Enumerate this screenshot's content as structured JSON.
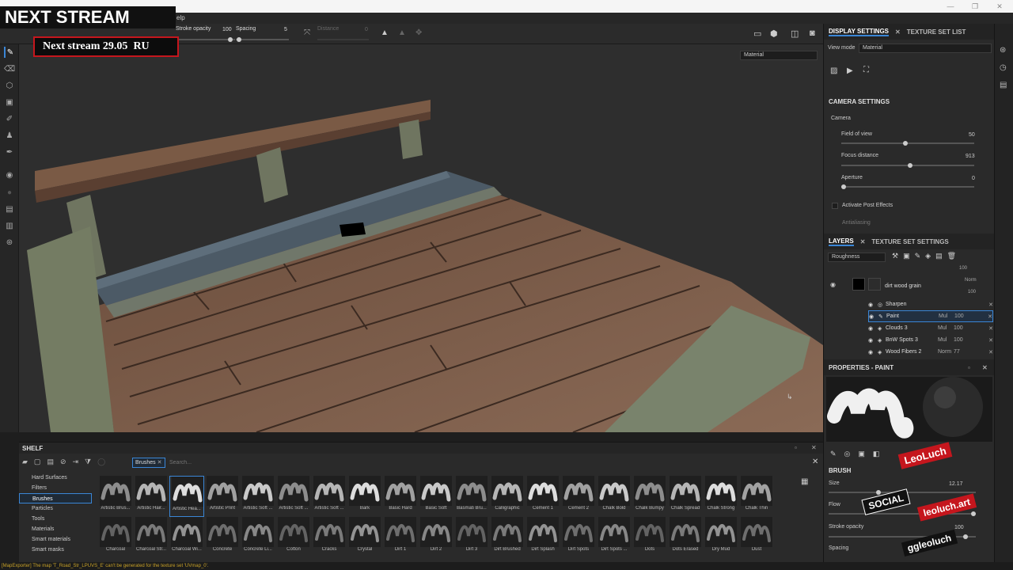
{
  "promo": {
    "title": "NEXT STREAM",
    "subtitle": "Next stream 29.05",
    "lang": "RU"
  },
  "menubar": {
    "help": "elp"
  },
  "toolbar": {
    "stroke_opacity_label": "Stroke opacity",
    "stroke_opacity_value": "100",
    "spacing_label": "Spacing",
    "spacing_value": "5",
    "distance_label": "Distance",
    "distance_value": "0"
  },
  "viewport": {
    "mode_select": "Material"
  },
  "display_settings": {
    "tab_display": "DISPLAY SETTINGS",
    "tab_texture_set_list": "TEXTURE SET LIST",
    "view_mode_label": "View mode",
    "view_mode_value": "Material",
    "camera_section": "CAMERA SETTINGS",
    "camera_label": "Camera",
    "fov_label": "Field of view",
    "fov_value": "50",
    "focus_label": "Focus distance",
    "focus_value": "913",
    "aperture_label": "Aperture",
    "aperture_value": "0",
    "post_effects": "Activate Post Effects",
    "antialiasing": "Antialiasing"
  },
  "layers": {
    "tab_layers": "LAYERS",
    "tab_texture_set_settings": "TEXTURE SET SETTINGS",
    "channel": "Roughness",
    "top_value": "100",
    "group": {
      "name": "dirt wood grain",
      "blend": "Norm",
      "opacity": "100"
    },
    "effects": [
      {
        "name": "Sharpen",
        "blend": "",
        "opacity": ""
      },
      {
        "name": "Paint",
        "blend": "Mul",
        "opacity": "100"
      },
      {
        "name": "Clouds 3",
        "blend": "Mul",
        "opacity": "100"
      },
      {
        "name": "BnW Spots 3",
        "blend": "Mul",
        "opacity": "100"
      },
      {
        "name": "Wood Fibers 2",
        "blend": "Norm",
        "opacity": "77"
      }
    ]
  },
  "properties": {
    "title": "PROPERTIES - PAINT",
    "brush_section": "BRUSH",
    "size_label": "Size",
    "size_value": "12.17",
    "flow_label": "Flow",
    "stroke_opacity_label": "Stroke opacity",
    "stroke_opacity_value": "100",
    "spacing_label": "Spacing"
  },
  "social": {
    "name": "LeoLuch",
    "social_label": "SOCIAL",
    "site": "leoluch.art",
    "vk": "ggleoluch"
  },
  "shelf": {
    "title": "SHELF",
    "filter_chip": "Brushes",
    "search_placeholder": "Search...",
    "categories": [
      "Hard Surfaces",
      "Filters",
      "Brushes",
      "Particles",
      "Tools",
      "Materials",
      "Smart materials",
      "Smart masks"
    ],
    "row1": [
      "Artistic Brus...",
      "Artistic Hair...",
      "Artistic Hea...",
      "Artistic Print",
      "Artistic Soft ...",
      "Artistic Soft ...",
      "Artistic Soft ...",
      "Bark",
      "Basic Hard",
      "Basic Soft",
      "Basmati Bru...",
      "Calligraphic",
      "Cement 1",
      "Cement 2",
      "Chalk Bold",
      "Chalk Bumpy",
      "Chalk Spread",
      "Chalk Strong",
      "Chalk Thin"
    ],
    "row2": [
      "Charcoal",
      "Charcoal Str...",
      "Charcoal Wi...",
      "Concrete",
      "Concrete Li...",
      "Cotton",
      "Cracks",
      "Crystal",
      "Dirt 1",
      "Dirt 2",
      "Dirt 3",
      "Dirt Brushed",
      "Dirt Splash",
      "Dirt Spots",
      "Dirt Spots ...",
      "Dots",
      "Dots Erased",
      "Dry Mud",
      "Dust"
    ]
  },
  "status": "[MapExporter] The map 'T_Road_Str_LPUVS_E' can't be generated for the texture set 'UVmap_0'."
}
